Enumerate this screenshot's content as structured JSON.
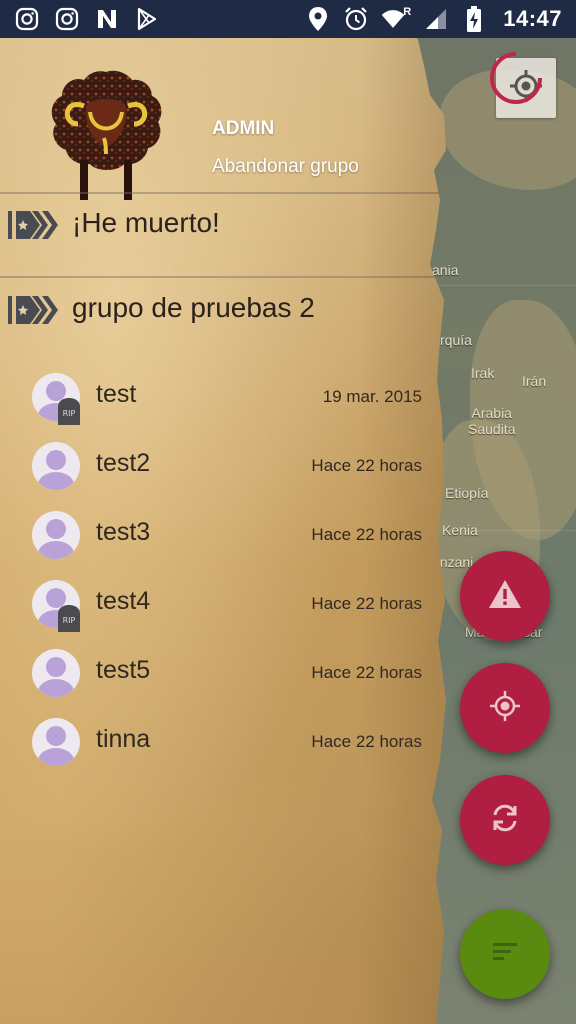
{
  "status_bar": {
    "time": "14:47",
    "left_icons": [
      "instagram-icon",
      "instagram-icon",
      "n-app-icon",
      "play-store-icon"
    ],
    "right_icons": [
      "location-icon",
      "alarm-icon",
      "wifi-icon",
      "signal-icon",
      "battery-charging-icon"
    ],
    "roaming_indicator": "R"
  },
  "drawer": {
    "user_name": "ADMIN",
    "leave_group_label": "Abandonar grupo",
    "groups": [
      {
        "name": "¡He muerto!",
        "members": []
      },
      {
        "name": "grupo de pruebas 2",
        "members": [
          {
            "name": "test",
            "last_seen": "19 mar. 2015",
            "dead": true
          },
          {
            "name": "test2",
            "last_seen": "Hace 22 horas",
            "dead": false
          },
          {
            "name": "test3",
            "last_seen": "Hace 22 horas",
            "dead": false
          },
          {
            "name": "test4",
            "last_seen": "Hace 22 horas",
            "dead": true
          },
          {
            "name": "test5",
            "last_seen": "Hace 22 horas",
            "dead": false
          },
          {
            "name": "tinna",
            "last_seen": "Hace 22 horas",
            "dead": false
          }
        ]
      }
    ],
    "rip_text": "RIP"
  },
  "map": {
    "labels": [
      "ania",
      "rquía",
      "Irak",
      "Irán",
      "Arabia\nSaudita",
      "Etiopía",
      "Kenia",
      "anzani",
      "Ma",
      "car"
    ]
  },
  "fabs": [
    {
      "name": "alert-fab",
      "icon": "warning-icon",
      "color": "#b01e42"
    },
    {
      "name": "target-fab",
      "icon": "crosshair-icon",
      "color": "#b01e42"
    },
    {
      "name": "refresh-fab",
      "icon": "refresh-icon",
      "color": "#b01e42"
    },
    {
      "name": "menu-fab",
      "icon": "sort-lines-icon",
      "color": "#5a8a10"
    }
  ],
  "colors": {
    "status_bar": "#1f2a44",
    "fab_primary": "#b01e42",
    "fab_secondary": "#5a8a10",
    "avatar": "#b9a2d8"
  }
}
